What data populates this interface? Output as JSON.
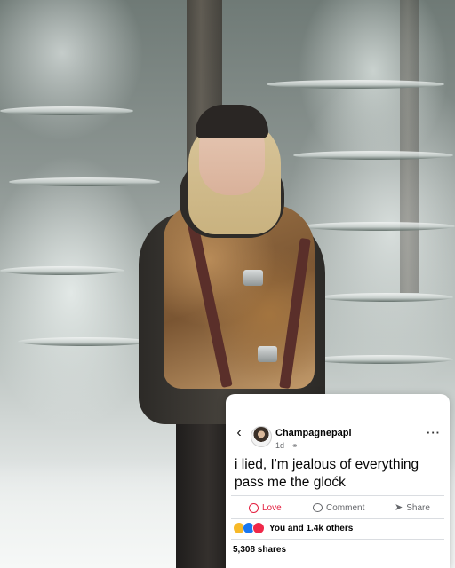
{
  "post": {
    "author": "Champagnepapi",
    "meta": "1d ·",
    "text_lines": [
      "i lied, I'm jealous of everything",
      "pass me the gloćk"
    ],
    "actions": {
      "love": "Love",
      "comment": "Comment",
      "share": "Share"
    },
    "reactions_text": "You and 1.4k others",
    "shares_text": "5,308 shares",
    "back_icon": "chevron-left-icon",
    "more_icon": "more-horizontal-icon",
    "privacy_icon": "globe-icon",
    "reaction_icons": [
      "haha-icon",
      "like-icon",
      "love-icon"
    ]
  },
  "colors": {
    "love_red": "#e41e3f",
    "meta_gray": "#65676b",
    "like_blue": "#1877f2",
    "haha_yellow": "#f7b928"
  }
}
